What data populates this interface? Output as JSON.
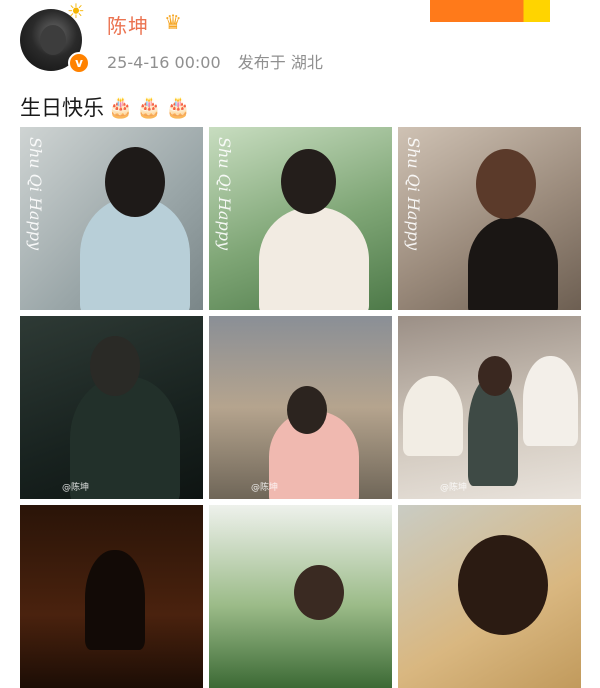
{
  "user": {
    "name": "陈坤",
    "timestamp": "25-4-16 00:00",
    "location_label": "发布于 湖北"
  },
  "badges": {
    "sun_icon": "sun-icon",
    "crown_icon": "crown-icon",
    "verified_icon": "verified-icon",
    "verified_glyph": "v"
  },
  "post": {
    "text": "生日快乐",
    "emojis": [
      "🎂",
      "🎂",
      "🎂"
    ]
  },
  "photos": [
    {
      "overlay": "Shu Qi Happy",
      "watermark": ""
    },
    {
      "overlay": "Shu Qi Happy",
      "watermark": ""
    },
    {
      "overlay": "Shu Qi Happy",
      "watermark": ""
    },
    {
      "overlay": "",
      "watermark": "@陈坤"
    },
    {
      "overlay": "",
      "watermark": "@陈坤"
    },
    {
      "overlay": "",
      "watermark": "@陈坤"
    },
    {
      "overlay": "",
      "watermark": ""
    },
    {
      "overlay": "",
      "watermark": ""
    },
    {
      "overlay": "",
      "watermark": ""
    }
  ],
  "colors": {
    "username": "#eb7350",
    "meta_text": "#8f8f8f",
    "accent_orange": "#ff7a1a",
    "accent_yellow": "#ffd400"
  }
}
